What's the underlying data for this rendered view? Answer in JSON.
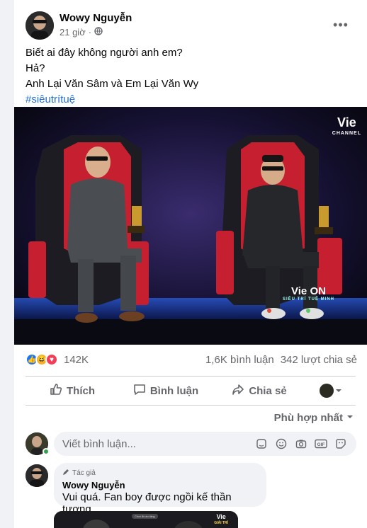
{
  "post": {
    "author": "Wowy Nguyễn",
    "time": "21 giờ",
    "lines": [
      "Biết ai đây không người anh em?",
      "Hả?",
      "Anh Lại Văn Sâm và Em Lại Văn Wy"
    ],
    "hashtag": "#siêutrítuệ",
    "more_label": "•••"
  },
  "video": {
    "channel_logo": "Vie",
    "channel_sub": "CHANNEL",
    "show_logo": "Vie ON",
    "show_sub": "SIÊU TRÍ TUỆ MINH"
  },
  "stats": {
    "reactions": 142000,
    "reactions_label": "142K",
    "reaction_icons": [
      "like-icon",
      "haha-icon",
      "love-icon"
    ],
    "comments": "1,6K bình luận",
    "shares": "342 lượt chia sẻ"
  },
  "actions": {
    "like": "Thích",
    "comment": "Bình luận",
    "share": "Chia sẻ"
  },
  "sort_label": "Phù hợp nhất",
  "composer": {
    "placeholder": "Viết bình luận...",
    "tool_icons": [
      "sticker-icon",
      "emoji-icon",
      "camera-icon",
      "gif-icon",
      "sticker-face-icon"
    ]
  },
  "comments": [
    {
      "tag": "Tác giả",
      "name": "Wowy Nguyễn",
      "text": "Vui quá. Fan boy được ngồi kế thần tượng",
      "media_label": "Vie",
      "media_sub": "GIẢI TRÍ",
      "media_chip": "Chơi đồ án tặng"
    }
  ],
  "colors": {
    "link": "#216fdb",
    "like": "#1877f2",
    "online": "#31a24c",
    "chair_red": "#c62030",
    "stage_bg": "#0b0b14"
  }
}
